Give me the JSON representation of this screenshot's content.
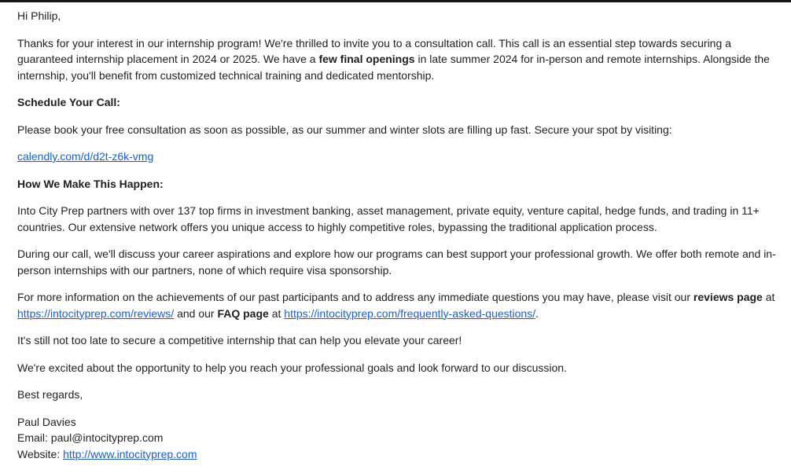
{
  "email": {
    "greeting": "Hi Philip,",
    "intro": {
      "part1": "Thanks for your interest in our internship program! We're thrilled to invite you to a consultation call. This call is an essential step towards securing a guaranteed internship placement in 2024 or 2025. We have a ",
      "bold": "few final openings",
      "part2": " in late summer 2024 for in-person and remote internships. Alongside the internship, you'll benefit from customized technical training and dedicated mentorship."
    },
    "schedule_heading": "Schedule Your Call:",
    "schedule_text": "Please book your free consultation as soon as possible, as our summer and winter slots are filling up fast. Secure your spot by visiting:",
    "schedule_link": "calendly.com/d/d2t-z6k-vmg",
    "how_heading": "How We Make This Happen:",
    "how_text": "Into City Prep partners with over 137 top firms in investment banking, asset management, private equity, venture capital, hedge funds, and trading in 11+ countries. Our extensive network offers you unique access to highly competitive roles, bypassing the traditional application process.",
    "call_text": "During our call, we'll discuss your career aspirations and explore how our programs can best support your professional growth. We offer both remote and in-person internships with our partners, none of which require visa sponsorship.",
    "info": {
      "part1": "For more information on the achievements of our past participants and to address any immediate questions you may have, please visit our ",
      "reviews_bold": "reviews page",
      "at1": " at ",
      "reviews_link": "https://intocityprep.com/reviews/",
      "and_our": " and our ",
      "faq_bold": "FAQ page",
      "at2": " at ",
      "faq_link": "https://intocityprep.com/frequently-asked-questions/",
      "end": "."
    },
    "not_too_late": "It's still not too late to secure a competitive internship that can help you elevate your career!",
    "excited": "We're excited about the opportunity to help you reach your professional goals and look forward to our discussion.",
    "closing": "Best regards,",
    "signature": {
      "name": "Paul Davies",
      "email_line": "Email: paul@intocityprep.com",
      "website_label": "Website: ",
      "website_link": "http://www.intocityprep.com"
    }
  }
}
